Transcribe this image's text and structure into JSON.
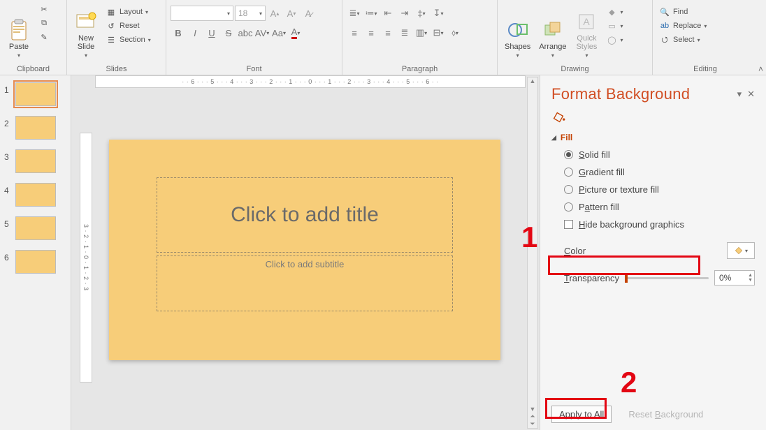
{
  "ribbon": {
    "groups": {
      "clipboard": {
        "label": "Clipboard",
        "paste": "Paste"
      },
      "slides": {
        "label": "Slides",
        "new_slide": "New\nSlide",
        "layout": "Layout",
        "reset": "Reset",
        "section": "Section"
      },
      "font": {
        "label": "Font",
        "font_name": "",
        "font_size": "18"
      },
      "paragraph": {
        "label": "Paragraph"
      },
      "drawing": {
        "label": "Drawing",
        "shapes": "Shapes",
        "arrange": "Arrange",
        "quick": "Quick\nStyles"
      },
      "editing": {
        "label": "Editing",
        "find": "Find",
        "replace": "Replace",
        "select": "Select"
      }
    }
  },
  "ruler_h": "· · 6 · · · 5 · · · 4 · · · 3 · · · 2 · · · 1 · · · 0 · · · 1 · · · 2 · · · 3 · · · 4 · · · 5 · · · 6 · ·",
  "ruler_v": "3 · 2 · 1 · 0 · 1 · 2 · 3",
  "thumbnails": [
    1,
    2,
    3,
    4,
    5,
    6
  ],
  "selected_thumb": 1,
  "slide": {
    "title_ph": "Click to add title",
    "subtitle_ph": "Click to add subtitle"
  },
  "pane": {
    "title": "Format Background",
    "section": "Fill",
    "opts": {
      "solid": "Solid fill",
      "gradient": "Gradient fill",
      "picture": "Picture or texture fill",
      "pattern": "Pattern fill",
      "hide": "Hide background graphics"
    },
    "color_label": "Color",
    "transparency_label": "Transparency",
    "transparency_value": "0%",
    "apply_all": "Apply to All",
    "reset": "Reset Background"
  },
  "annotations": {
    "one": "1",
    "two": "2"
  }
}
